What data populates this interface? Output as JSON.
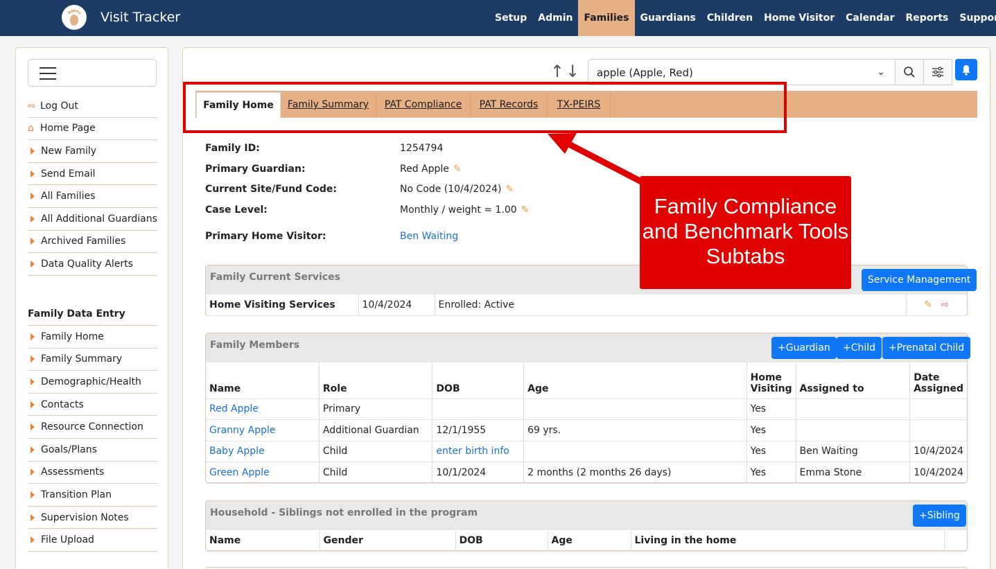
{
  "app": {
    "title": "Visit Tracker"
  },
  "nav": [
    "Setup",
    "Admin",
    "Families",
    "Guardians",
    "Children",
    "Home Visitor",
    "Calendar",
    "Reports",
    "Support"
  ],
  "nav_active": "Families",
  "sidebar": {
    "items": [
      {
        "label": "Log Out",
        "icon": "logout-icon"
      },
      {
        "label": "Home Page",
        "icon": "home-icon"
      },
      {
        "label": "New Family",
        "icon": "caret-right-icon"
      },
      {
        "label": "Send Email",
        "icon": "caret-right-icon"
      },
      {
        "label": "All Families",
        "icon": "caret-right-icon"
      },
      {
        "label": "All Additional Guardians",
        "icon": "caret-right-icon"
      },
      {
        "label": "Archived Families",
        "icon": "caret-right-icon"
      },
      {
        "label": "Data Quality Alerts",
        "icon": "caret-right-icon"
      }
    ],
    "section_heading": "Family Data Entry",
    "section_items": [
      "Family Home",
      "Family Summary",
      "Demographic/Health",
      "Contacts",
      "Resource Connection",
      "Goals/Plans",
      "Assessments",
      "Transition Plan",
      "Supervision Notes",
      "File Upload"
    ]
  },
  "search": {
    "value": "apple (Apple, Red)"
  },
  "tabs": [
    "Family Home",
    "Family Summary",
    "PAT Compliance",
    "PAT Records",
    "TX-PEIRS"
  ],
  "callout": {
    "text": "Family Compliance and Benchmark Tools Subtabs"
  },
  "family_info": {
    "family_id_label": "Family ID:",
    "family_id": "1254794",
    "primary_guardian_label": "Primary Guardian:",
    "primary_guardian": "Red Apple",
    "site_label": "Current Site/Fund Code:",
    "site": "No Code (10/4/2024)",
    "case_level_label": "Case Level:",
    "case_level": "Monthly / weight = 1.00",
    "home_visitor_label": "Primary Home Visitor:",
    "home_visitor": "Ben Waiting"
  },
  "current_services": {
    "title": "Family Current Services",
    "button": "Service Management",
    "row": {
      "service": "Home Visiting Services",
      "date": "10/4/2024",
      "status": "Enrolled: Active"
    }
  },
  "family_members": {
    "title": "Family Members",
    "buttons": [
      "+Guardian",
      "+Child",
      "+Prenatal Child"
    ],
    "columns": [
      "Name",
      "Role",
      "DOB",
      "Age",
      "Home Visiting",
      "Assigned to",
      "Date Assigned"
    ],
    "rows": [
      [
        "Red Apple",
        "Primary",
        "",
        "",
        "Yes",
        "",
        ""
      ],
      [
        "Granny Apple",
        "Additional Guardian",
        "12/1/1955",
        "69 yrs.",
        "Yes",
        "",
        ""
      ],
      [
        "Baby Apple",
        "Child",
        "enter birth info",
        "",
        "Yes",
        "Ben Waiting",
        "10/4/2024"
      ],
      [
        "Green Apple",
        "Child",
        "10/1/2024",
        "2 months (2 months 26 days)",
        "Yes",
        "Emma Stone",
        "10/4/2024"
      ]
    ]
  },
  "household": {
    "title": "Household - Siblings not enrolled in the program",
    "button": "+Sibling",
    "columns": [
      "Name",
      "Gender",
      "DOB",
      "Age",
      "Living in the home"
    ]
  },
  "colors": {
    "navbar": "#1c3c66",
    "accent": "#e6b185",
    "primary_button": "#1178f5",
    "callout": "#e00000"
  }
}
